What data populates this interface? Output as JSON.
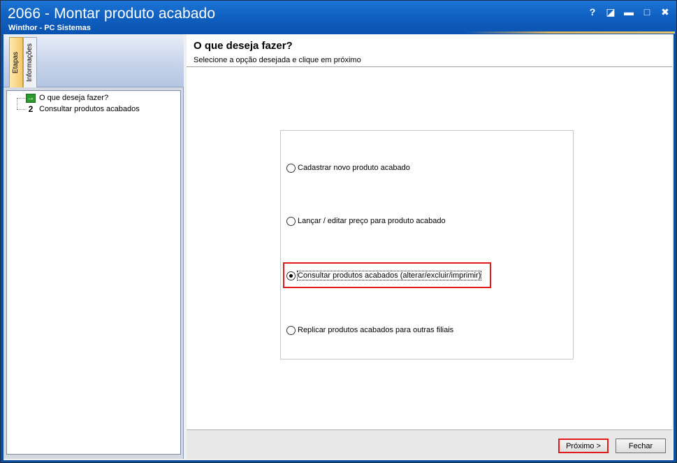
{
  "window": {
    "title": "2066 - Montar produto acabado",
    "subtitle": "Winthor - PC Sistemas",
    "controls": {
      "help": "?",
      "restore": "◪",
      "minimize": "▬",
      "maximize": "□",
      "close": "✖"
    }
  },
  "left": {
    "tabs": [
      {
        "label": "Etapas",
        "active": true
      },
      {
        "label": "Informações",
        "active": false
      }
    ],
    "steps": [
      {
        "marker": "→",
        "icon": "green-arrow-icon",
        "label": "O que deseja fazer?"
      },
      {
        "marker": "2",
        "icon": "step-number-icon",
        "label": "Consultar produtos acabados"
      }
    ]
  },
  "main": {
    "title": "O que deseja fazer?",
    "subtitle": "Selecione a opção desejada e clique em próximo",
    "options": [
      {
        "label": "Cadastrar novo produto acabado",
        "checked": false
      },
      {
        "label": "Lançar / editar preço para produto acabado",
        "checked": false
      },
      {
        "label": "Consultar produtos acabados (alterar/excluir/imprimir)",
        "checked": true
      },
      {
        "label": "Replicar produtos acabados para outras filiais",
        "checked": false
      }
    ]
  },
  "footer": {
    "next_label": "Próximo >",
    "close_label": "Fechar"
  },
  "colors": {
    "titlebar": "#0f5fc0",
    "highlight": "#e01b1b",
    "active_tab": "#f6c86a",
    "step_arrow": "#2a9a2e"
  }
}
